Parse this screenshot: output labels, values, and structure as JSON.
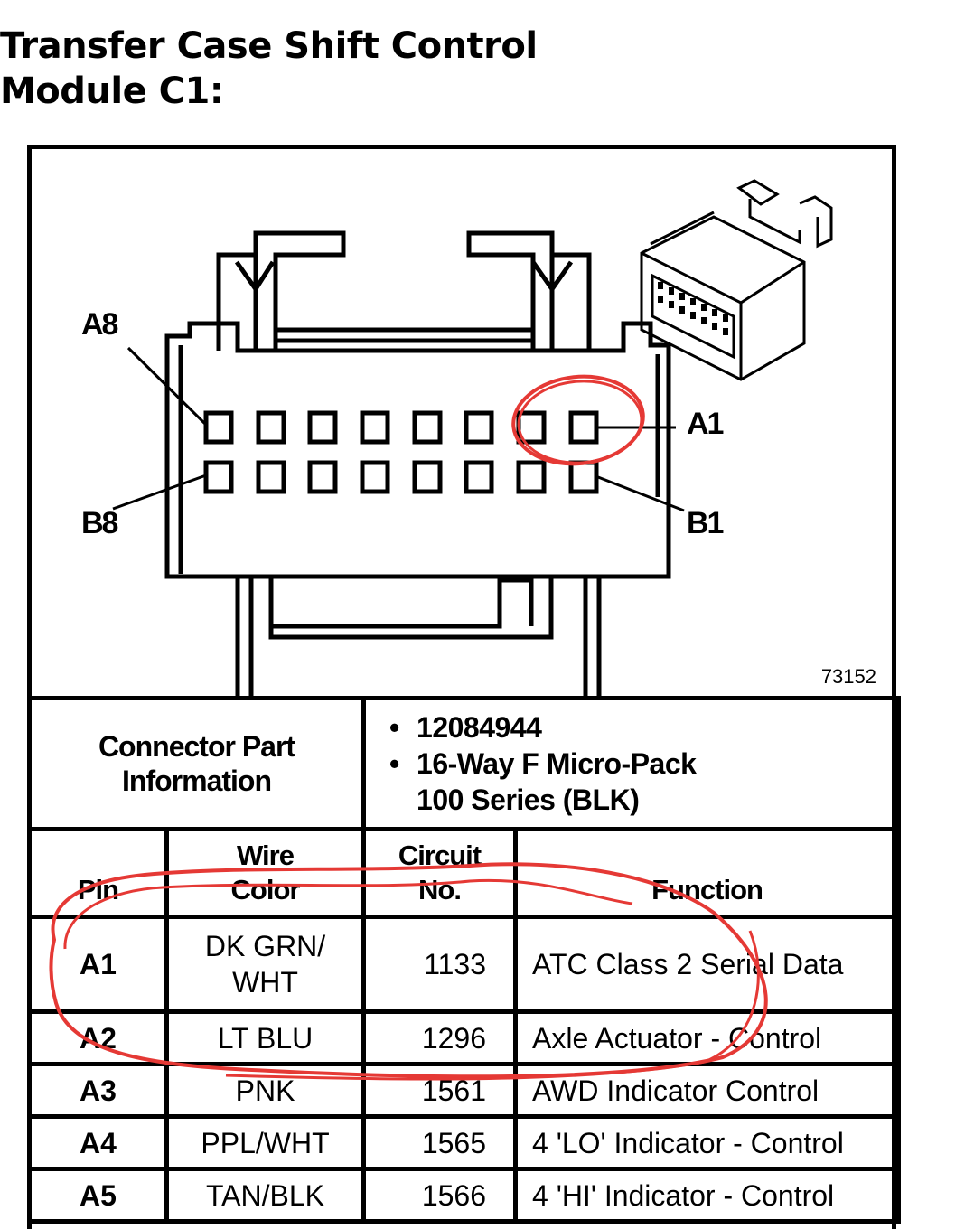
{
  "document": {
    "title_line1": "Transfer Case Shift Control",
    "title_line2": "Module C1:"
  },
  "figure": {
    "pin_labels": {
      "a8": "A8",
      "b8": "B8",
      "a1": "A1",
      "b1": "B1"
    },
    "rows": [
      "A",
      "B"
    ],
    "pins_per_row": 8,
    "figure_number": "73152",
    "highlight_color": "#e53935"
  },
  "connector_info": {
    "label": "Connector Part Information",
    "label_line1": "Connector Part",
    "label_line2": "Information",
    "part_number": "12084944",
    "description_line1": "16-Way F Micro-Pack",
    "description_line2": "100 Series (BLK)"
  },
  "pin_table": {
    "headers": {
      "pin": "Pin",
      "wire_color_line1": "Wire",
      "wire_color_line2": "Color",
      "circuit_line1": "Circuit",
      "circuit_line2": "No.",
      "function": "Function"
    },
    "rows": [
      {
        "pin": "A1",
        "wire_color_line1": "DK GRN/",
        "wire_color_line2": "WHT",
        "circuit": "1133",
        "function": "ATC Class 2 Serial Data"
      },
      {
        "pin": "A2",
        "wire_color": "LT BLU",
        "circuit": "1296",
        "function": "Axle Actuator - Control"
      },
      {
        "pin": "A3",
        "wire_color": "PNK",
        "circuit": "1561",
        "function": "AWD Indicator Control"
      },
      {
        "pin": "A4",
        "wire_color": "PPL/WHT",
        "circuit": "1565",
        "function": "4 'LO' Indicator - Control"
      },
      {
        "pin": "A5",
        "wire_color": "TAN/BLK",
        "circuit": "1566",
        "function": "4 'HI' Indicator - Control"
      }
    ]
  }
}
